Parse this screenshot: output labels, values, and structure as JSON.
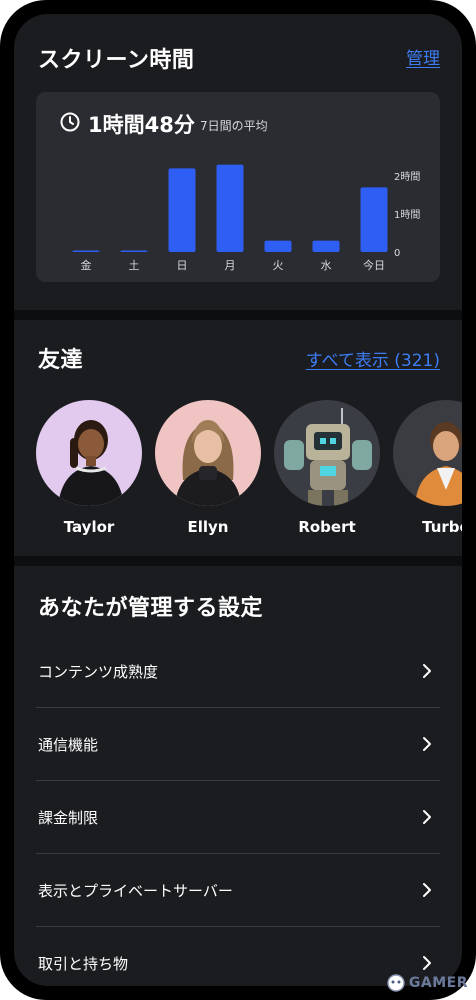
{
  "screen_time": {
    "title": "スクリーン時間",
    "manage_link": "管理",
    "total": "1時間48分",
    "average_label": "7日間の平均",
    "chart_data": {
      "type": "bar",
      "categories": [
        "金",
        "土",
        "日",
        "月",
        "火",
        "水",
        "今日"
      ],
      "values": [
        0.02,
        0.02,
        2.2,
        2.3,
        0.3,
        0.3,
        1.7
      ],
      "ylim": [
        0,
        2
      ],
      "y_tick_labels": [
        "2時間",
        "1時間",
        "0"
      ],
      "bar_color": "#2f5ef5",
      "grid": false
    }
  },
  "friends": {
    "title": "友達",
    "view_all_link": "すべて表示 (321)",
    "items": [
      {
        "name": "Taylor"
      },
      {
        "name": "Ellyn"
      },
      {
        "name": "Robert"
      },
      {
        "name": "Turbo"
      }
    ]
  },
  "settings": {
    "title": "あなたが管理する設定",
    "items": [
      {
        "label": "コンテンツ成熟度"
      },
      {
        "label": "通信機能"
      },
      {
        "label": "課金制限"
      },
      {
        "label": "表示とプライベートサーバー"
      },
      {
        "label": "取引と持ち物"
      }
    ]
  },
  "watermark": {
    "text": "GAMER"
  },
  "colors": {
    "accent": "#3d7cf5",
    "bar": "#2f5ef5",
    "panel": "#1b1c1f",
    "card": "#2b2c31"
  }
}
